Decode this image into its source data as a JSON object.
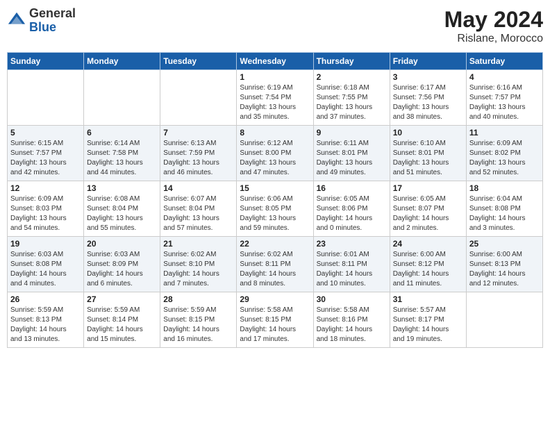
{
  "header": {
    "logo_general": "General",
    "logo_blue": "Blue",
    "month": "May 2024",
    "location": "Rislane, Morocco"
  },
  "days_of_week": [
    "Sunday",
    "Monday",
    "Tuesday",
    "Wednesday",
    "Thursday",
    "Friday",
    "Saturday"
  ],
  "weeks": [
    [
      {
        "day": "",
        "info": ""
      },
      {
        "day": "",
        "info": ""
      },
      {
        "day": "",
        "info": ""
      },
      {
        "day": "1",
        "info": "Sunrise: 6:19 AM\nSunset: 7:54 PM\nDaylight: 13 hours\nand 35 minutes."
      },
      {
        "day": "2",
        "info": "Sunrise: 6:18 AM\nSunset: 7:55 PM\nDaylight: 13 hours\nand 37 minutes."
      },
      {
        "day": "3",
        "info": "Sunrise: 6:17 AM\nSunset: 7:56 PM\nDaylight: 13 hours\nand 38 minutes."
      },
      {
        "day": "4",
        "info": "Sunrise: 6:16 AM\nSunset: 7:57 PM\nDaylight: 13 hours\nand 40 minutes."
      }
    ],
    [
      {
        "day": "5",
        "info": "Sunrise: 6:15 AM\nSunset: 7:57 PM\nDaylight: 13 hours\nand 42 minutes."
      },
      {
        "day": "6",
        "info": "Sunrise: 6:14 AM\nSunset: 7:58 PM\nDaylight: 13 hours\nand 44 minutes."
      },
      {
        "day": "7",
        "info": "Sunrise: 6:13 AM\nSunset: 7:59 PM\nDaylight: 13 hours\nand 46 minutes."
      },
      {
        "day": "8",
        "info": "Sunrise: 6:12 AM\nSunset: 8:00 PM\nDaylight: 13 hours\nand 47 minutes."
      },
      {
        "day": "9",
        "info": "Sunrise: 6:11 AM\nSunset: 8:01 PM\nDaylight: 13 hours\nand 49 minutes."
      },
      {
        "day": "10",
        "info": "Sunrise: 6:10 AM\nSunset: 8:01 PM\nDaylight: 13 hours\nand 51 minutes."
      },
      {
        "day": "11",
        "info": "Sunrise: 6:09 AM\nSunset: 8:02 PM\nDaylight: 13 hours\nand 52 minutes."
      }
    ],
    [
      {
        "day": "12",
        "info": "Sunrise: 6:09 AM\nSunset: 8:03 PM\nDaylight: 13 hours\nand 54 minutes."
      },
      {
        "day": "13",
        "info": "Sunrise: 6:08 AM\nSunset: 8:04 PM\nDaylight: 13 hours\nand 55 minutes."
      },
      {
        "day": "14",
        "info": "Sunrise: 6:07 AM\nSunset: 8:04 PM\nDaylight: 13 hours\nand 57 minutes."
      },
      {
        "day": "15",
        "info": "Sunrise: 6:06 AM\nSunset: 8:05 PM\nDaylight: 13 hours\nand 59 minutes."
      },
      {
        "day": "16",
        "info": "Sunrise: 6:05 AM\nSunset: 8:06 PM\nDaylight: 14 hours\nand 0 minutes."
      },
      {
        "day": "17",
        "info": "Sunrise: 6:05 AM\nSunset: 8:07 PM\nDaylight: 14 hours\nand 2 minutes."
      },
      {
        "day": "18",
        "info": "Sunrise: 6:04 AM\nSunset: 8:08 PM\nDaylight: 14 hours\nand 3 minutes."
      }
    ],
    [
      {
        "day": "19",
        "info": "Sunrise: 6:03 AM\nSunset: 8:08 PM\nDaylight: 14 hours\nand 4 minutes."
      },
      {
        "day": "20",
        "info": "Sunrise: 6:03 AM\nSunset: 8:09 PM\nDaylight: 14 hours\nand 6 minutes."
      },
      {
        "day": "21",
        "info": "Sunrise: 6:02 AM\nSunset: 8:10 PM\nDaylight: 14 hours\nand 7 minutes."
      },
      {
        "day": "22",
        "info": "Sunrise: 6:02 AM\nSunset: 8:11 PM\nDaylight: 14 hours\nand 8 minutes."
      },
      {
        "day": "23",
        "info": "Sunrise: 6:01 AM\nSunset: 8:11 PM\nDaylight: 14 hours\nand 10 minutes."
      },
      {
        "day": "24",
        "info": "Sunrise: 6:00 AM\nSunset: 8:12 PM\nDaylight: 14 hours\nand 11 minutes."
      },
      {
        "day": "25",
        "info": "Sunrise: 6:00 AM\nSunset: 8:13 PM\nDaylight: 14 hours\nand 12 minutes."
      }
    ],
    [
      {
        "day": "26",
        "info": "Sunrise: 5:59 AM\nSunset: 8:13 PM\nDaylight: 14 hours\nand 13 minutes."
      },
      {
        "day": "27",
        "info": "Sunrise: 5:59 AM\nSunset: 8:14 PM\nDaylight: 14 hours\nand 15 minutes."
      },
      {
        "day": "28",
        "info": "Sunrise: 5:59 AM\nSunset: 8:15 PM\nDaylight: 14 hours\nand 16 minutes."
      },
      {
        "day": "29",
        "info": "Sunrise: 5:58 AM\nSunset: 8:15 PM\nDaylight: 14 hours\nand 17 minutes."
      },
      {
        "day": "30",
        "info": "Sunrise: 5:58 AM\nSunset: 8:16 PM\nDaylight: 14 hours\nand 18 minutes."
      },
      {
        "day": "31",
        "info": "Sunrise: 5:57 AM\nSunset: 8:17 PM\nDaylight: 14 hours\nand 19 minutes."
      },
      {
        "day": "",
        "info": ""
      }
    ]
  ]
}
